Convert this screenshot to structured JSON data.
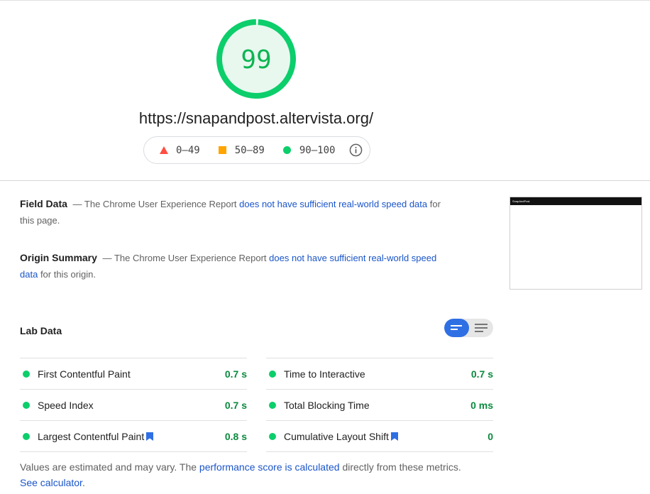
{
  "score": {
    "value": "99",
    "fraction": 0.99,
    "color": "#0cce6b",
    "track_color": "#e8f8ef"
  },
  "page": {
    "url": "https://snapandpost.altervista.org/"
  },
  "legend": {
    "items": [
      {
        "icon": "red-triangle-icon",
        "range": "0–49",
        "color": "#ff4e42"
      },
      {
        "icon": "orange-square-icon",
        "range": "50–89",
        "color": "#ffa400"
      },
      {
        "icon": "green-circle-icon",
        "range": "90–100",
        "color": "#0cce6b"
      }
    ],
    "info_icon": "info-icon"
  },
  "field_data": {
    "title": "Field Data",
    "dash": "—",
    "text_before": "The Chrome User Experience Report",
    "link": "does not have sufficient real-world speed data",
    "text_after": "for this page."
  },
  "origin_summary": {
    "title": "Origin Summary",
    "dash": "—",
    "text_before": "The Chrome User Experience Report",
    "link": "does not have sufficient real-world speed data",
    "text_after": "for this origin."
  },
  "thumbnail": {
    "header_text": "SnapAndPost"
  },
  "lab_data": {
    "title": "Lab Data",
    "toggle": {
      "options": [
        "compact-view-icon",
        "expanded-view-icon"
      ],
      "active": "compact-view-icon"
    },
    "left_metrics": [
      {
        "label": "First Contentful Paint",
        "value": "0.7 s",
        "bookmark": false
      },
      {
        "label": "Speed Index",
        "value": "0.7 s",
        "bookmark": false
      },
      {
        "label": "Largest Contentful Paint",
        "value": "0.8 s",
        "bookmark": true
      }
    ],
    "right_metrics": [
      {
        "label": "Time to Interactive",
        "value": "0.7 s",
        "bookmark": false
      },
      {
        "label": "Total Blocking Time",
        "value": "0 ms",
        "bookmark": false
      },
      {
        "label": "Cumulative Layout Shift",
        "value": "0",
        "bookmark": true
      }
    ]
  },
  "footer": {
    "text_before": "Values are estimated and may vary. The",
    "link1": "performance score is calculated",
    "text_middle": "directly from these metrics.",
    "link2": "See calculator",
    "text_end": "."
  },
  "colors": {
    "pass": "#0cce6b",
    "pass_text": "#0b8a3e",
    "link": "#1a55c9",
    "toggle_active": "#2f6fe4"
  }
}
